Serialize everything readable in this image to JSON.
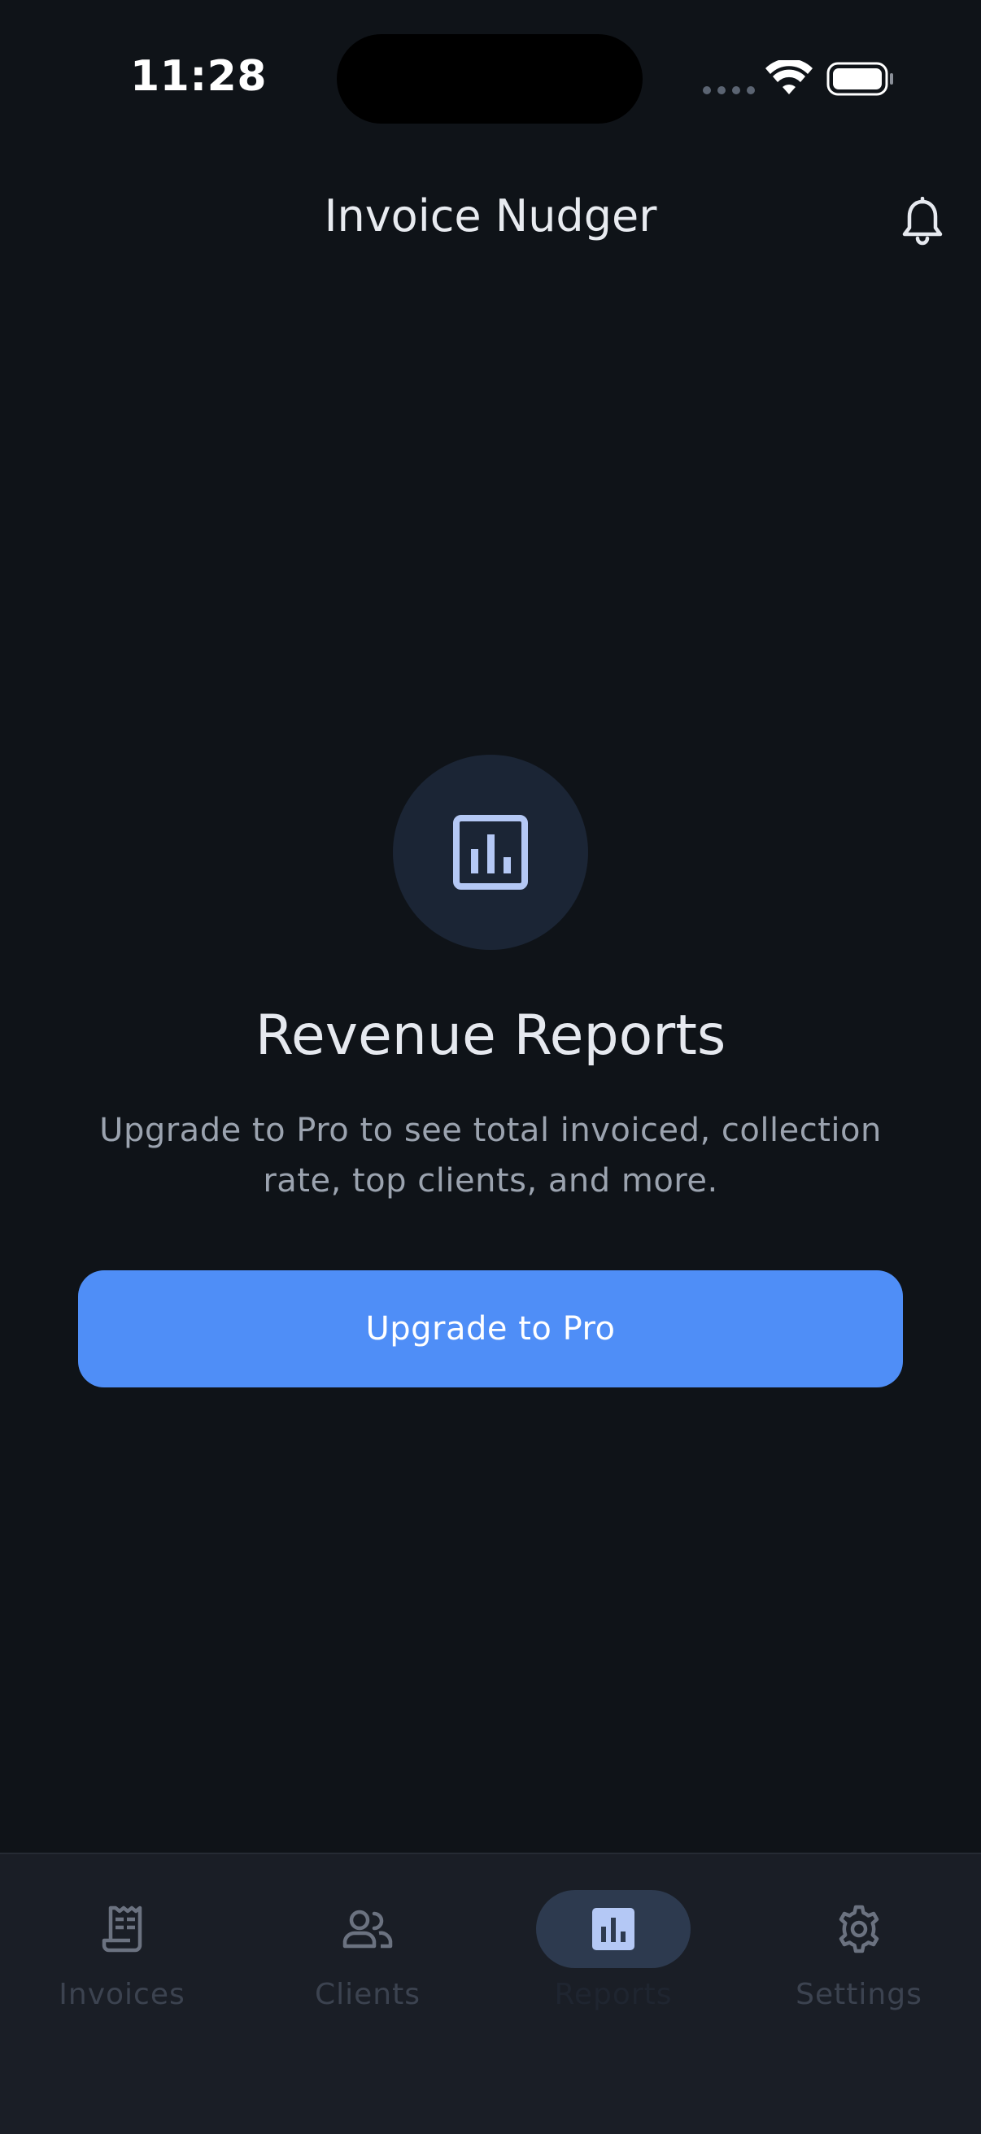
{
  "status_bar": {
    "time": "11:28"
  },
  "header": {
    "title": "Invoice Nudger",
    "notification_icon": "bell-icon"
  },
  "empty_state": {
    "icon": "bar-chart-icon",
    "title": "Revenue Reports",
    "subtitle": "Upgrade to Pro to see total invoiced, collection rate, top clients, and more.",
    "cta_label": "Upgrade to Pro"
  },
  "bottom_nav": {
    "items": [
      {
        "label": "Invoices",
        "icon": "receipt-icon",
        "active": false
      },
      {
        "label": "Clients",
        "icon": "people-icon",
        "active": false
      },
      {
        "label": "Reports",
        "icon": "bar-chart-icon",
        "active": true
      },
      {
        "label": "Settings",
        "icon": "gear-icon",
        "active": false
      }
    ]
  },
  "colors": {
    "background": "#0f1318",
    "accent": "#4f8ef7",
    "icon_tint": "#b4c8f5",
    "nav_background": "#1a1e26"
  }
}
